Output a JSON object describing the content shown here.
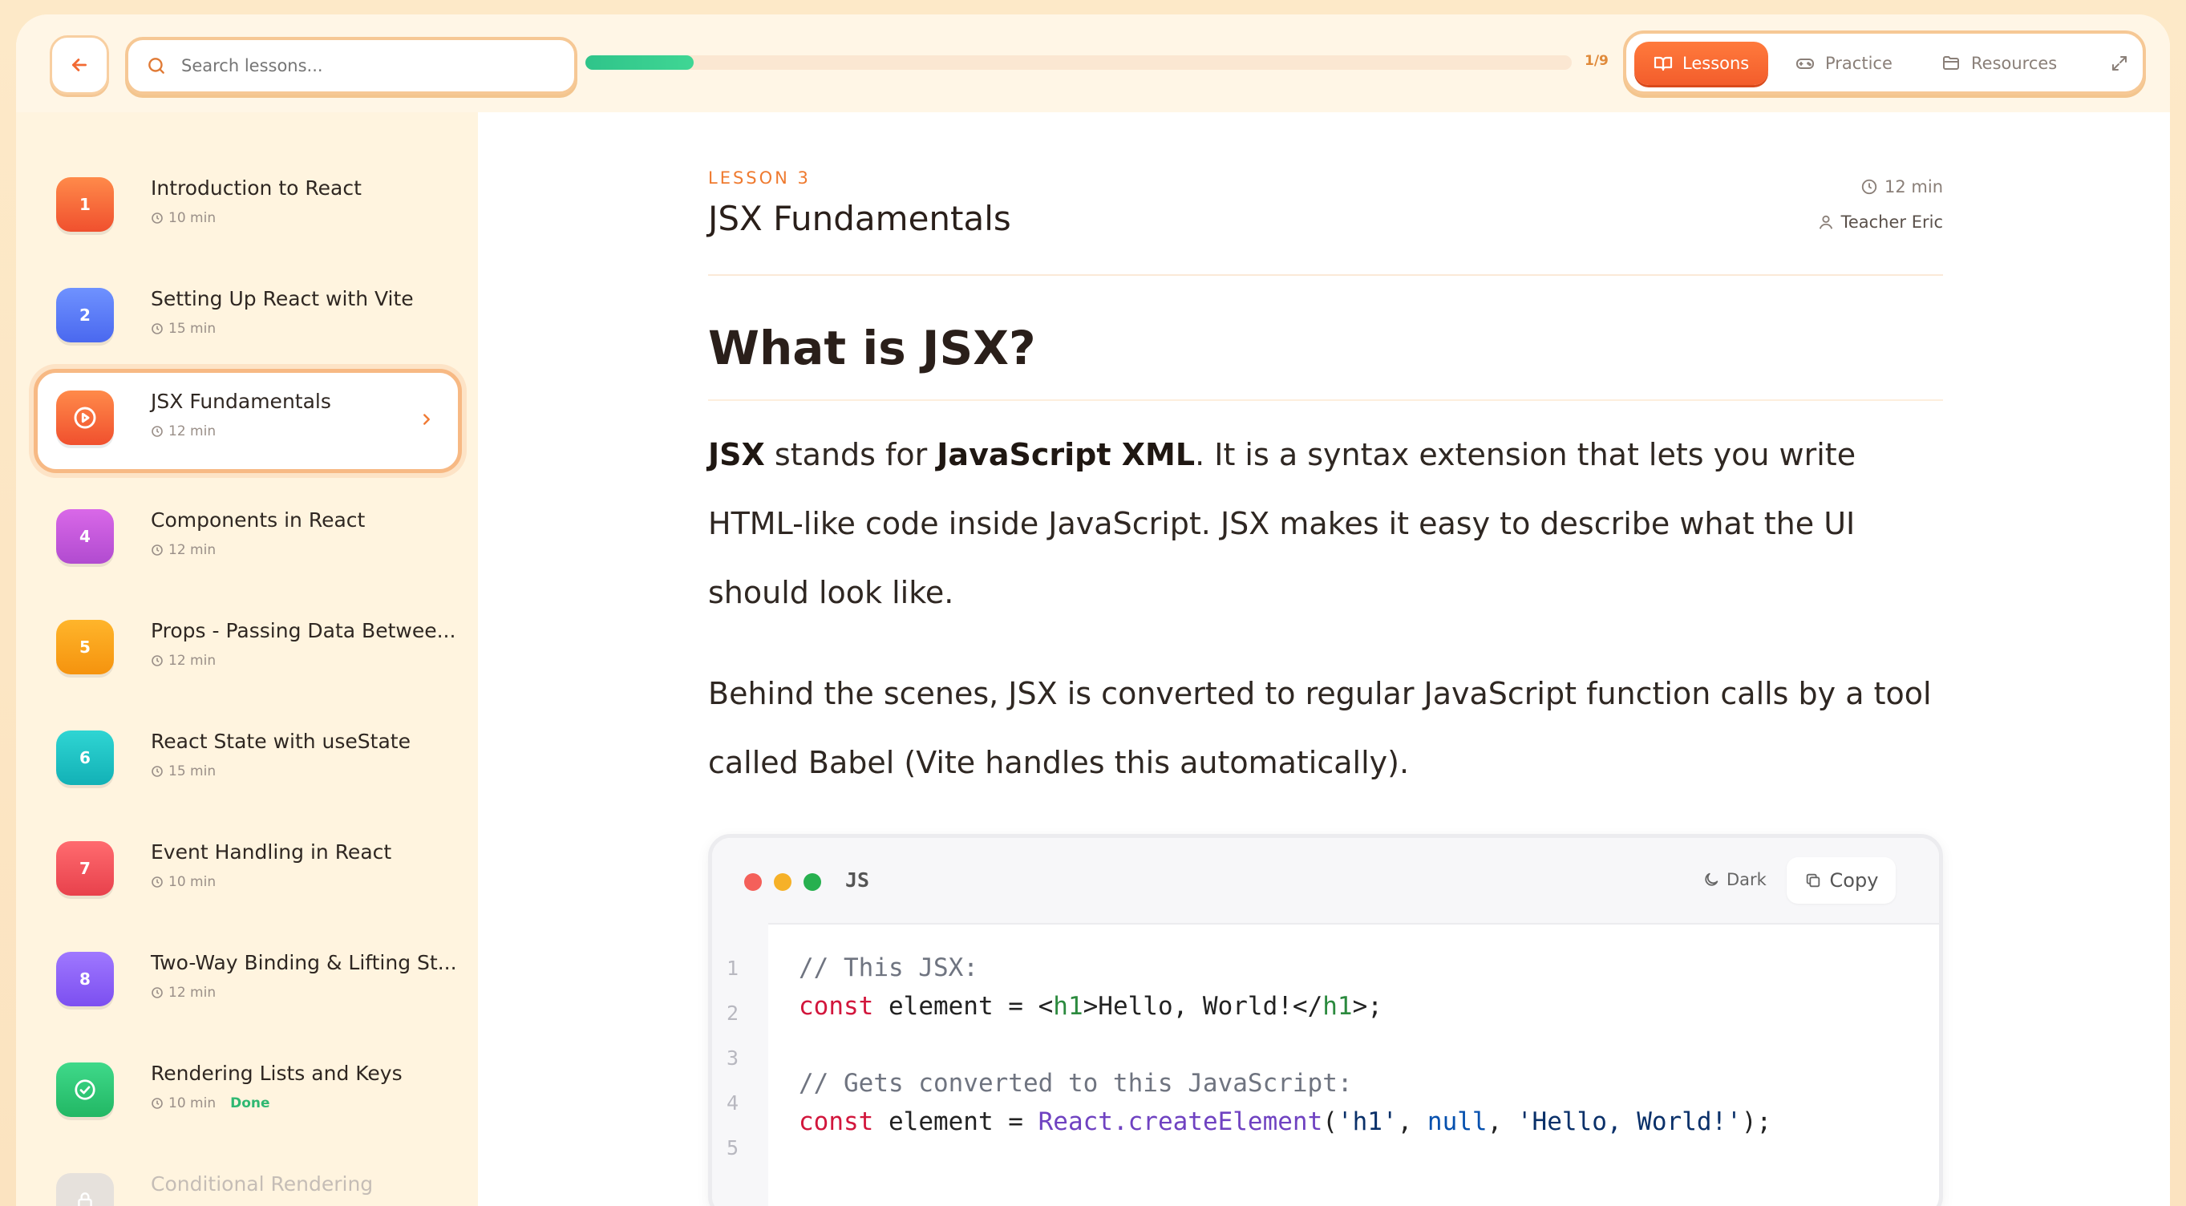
{
  "topbar": {
    "search_placeholder": "Search lessons...",
    "progress_fraction": 0.11,
    "progress_text": "1/9",
    "tabs": [
      {
        "label": "Lessons",
        "icon": "book-open-icon",
        "active": true
      },
      {
        "label": "Practice",
        "icon": "gamepad-icon",
        "active": false
      },
      {
        "label": "Resources",
        "icon": "folder-icon",
        "active": false
      }
    ]
  },
  "sidebar": {
    "items": [
      {
        "badge": "1",
        "title": "Introduction to React",
        "duration": "10 min",
        "color": "#f2643a",
        "state": "normal"
      },
      {
        "badge": "2",
        "title": "Setting Up React with Vite",
        "duration": "15 min",
        "color": "#5b7cf6",
        "state": "normal"
      },
      {
        "badge": "",
        "title": "JSX Fundamentals",
        "duration": "12 min",
        "color": "#f2643a",
        "state": "active"
      },
      {
        "badge": "4",
        "title": "Components in React",
        "duration": "12 min",
        "color": "#c45bd6",
        "state": "normal"
      },
      {
        "badge": "5",
        "title": "Props - Passing Data Betwee...",
        "duration": "12 min",
        "color": "#f7a21b",
        "state": "normal"
      },
      {
        "badge": "6",
        "title": "React State with useState",
        "duration": "15 min",
        "color": "#19c2c5",
        "state": "normal"
      },
      {
        "badge": "7",
        "title": "Event Handling in React",
        "duration": "10 min",
        "color": "#f0515a",
        "state": "normal"
      },
      {
        "badge": "8",
        "title": "Two-Way Binding & Lifting St...",
        "duration": "12 min",
        "color": "#8a5cf6",
        "state": "normal"
      },
      {
        "badge": "",
        "title": "Rendering Lists and Keys",
        "duration": "10 min",
        "color": "#2fc26f",
        "state": "done",
        "done_label": "Done"
      },
      {
        "badge": "",
        "title": "Conditional Rendering",
        "duration": "",
        "color": "#e0dbd6",
        "state": "locked"
      }
    ]
  },
  "lesson": {
    "label": "LESSON 3",
    "title": "JSX Fundamentals",
    "duration": "12 min",
    "teacher": "Teacher Eric",
    "heading": "What is JSX?",
    "p1": {
      "b1": "JSX",
      "t1": " stands for ",
      "b2": "JavaScript XML",
      "t2": ". It is a syntax extension that lets you write HTML-like code inside JavaScript. JSX makes it easy to describe what the UI should look like."
    },
    "p2": "Behind the scenes, JSX is converted to regular JavaScript function calls by a tool called Babel (Vite handles this automatically)."
  },
  "code": {
    "language": "JS",
    "dark_label": "Dark",
    "copy_label": "Copy",
    "line_numbers": [
      "1",
      "2",
      "3",
      "4",
      "5"
    ],
    "lines": {
      "l1_comment": "// This JSX:",
      "l2_kw": "const",
      "l2_a": " element = <",
      "l2_tag1": "h1",
      "l2_b": ">Hello, World!</",
      "l2_tag2": "h1",
      "l2_c": ">;",
      "l4_comment": "// Gets converted to this JavaScript:",
      "l5_kw": "const",
      "l5_a": " element = ",
      "l5_obj": "React.createElement",
      "l5_b": "(",
      "l5_s1": "'h1'",
      "l5_c": ", ",
      "l5_null": "null",
      "l5_d": ", ",
      "l5_s2": "'Hello, World!'",
      "l5_e": ");"
    }
  }
}
